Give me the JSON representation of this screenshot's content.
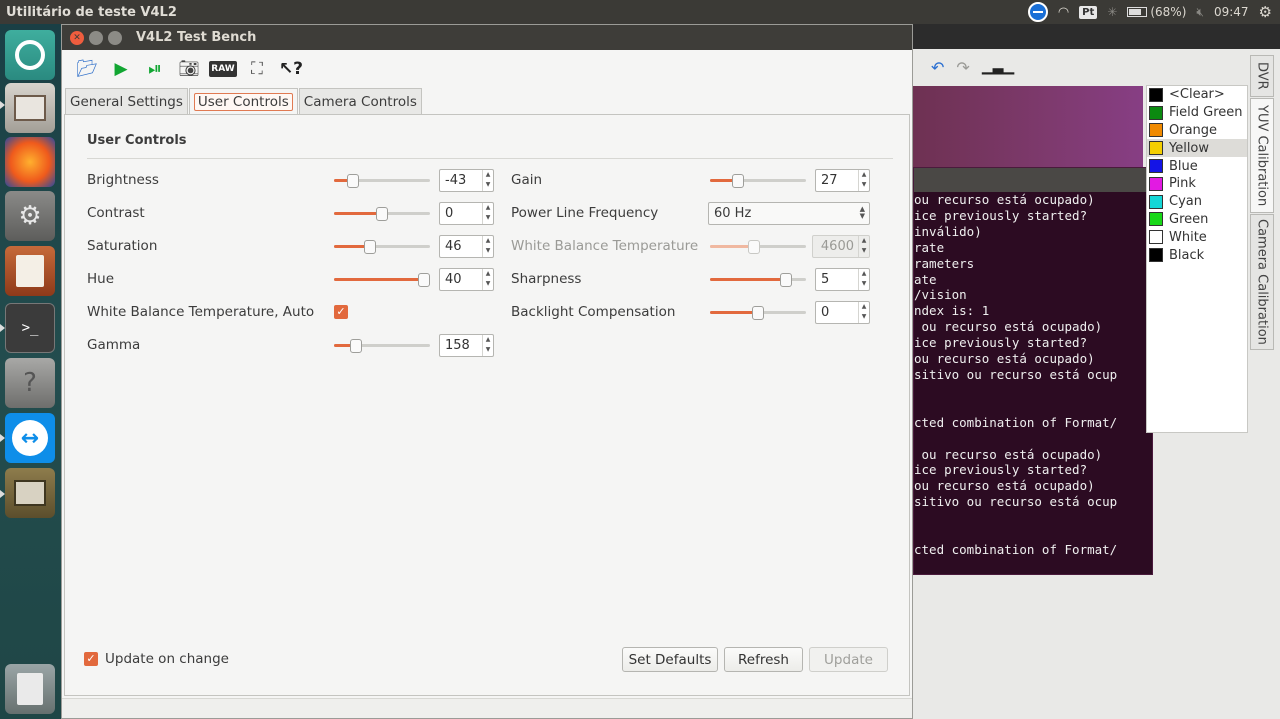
{
  "topbar": {
    "app_title": "Utilitário de teste V4L2",
    "keyboard_layout": "Pt",
    "battery": "(68%)",
    "clock": "09:47"
  },
  "launcher": {
    "items": [
      "ubuntu-dash",
      "files",
      "firefox",
      "system-settings",
      "impress",
      "terminal",
      "help",
      "teamviewer",
      "window"
    ]
  },
  "window": {
    "title": "V4L2 Test Bench",
    "tabs": [
      {
        "label": "General Settings"
      },
      {
        "label": "User Controls"
      },
      {
        "label": "Camera Controls"
      }
    ],
    "group_title": "User Controls",
    "left_controls": [
      {
        "label": "Brightness",
        "value": "-43",
        "fraction": 0.2
      },
      {
        "label": "Contrast",
        "value": "0",
        "fraction": 0.5
      },
      {
        "label": "Saturation",
        "value": "46",
        "fraction": 0.37
      },
      {
        "label": "Hue",
        "value": "40",
        "fraction": 0.94
      },
      {
        "label": "White Balance Temperature, Auto",
        "checked": true
      },
      {
        "label": "Gamma",
        "value": "158",
        "fraction": 0.23
      }
    ],
    "right_controls": [
      {
        "label": "Gain",
        "value": "27",
        "fraction": 0.29
      },
      {
        "label": "Power Line Frequency",
        "select_value": "60 Hz"
      },
      {
        "label": "White Balance Temperature",
        "value": "4600",
        "fraction": 0.46,
        "disabled": true
      },
      {
        "label": "Sharpness",
        "value": "5",
        "fraction": 0.79
      },
      {
        "label": "Backlight Compensation",
        "value": "0",
        "fraction": 0.5
      }
    ],
    "update_on_change": "Update on change",
    "buttons": {
      "set_defaults": "Set Defaults",
      "refresh": "Refresh",
      "update": "Update"
    }
  },
  "background": {
    "terminal_lines": [
      "ou recurso está ocupado)",
      "ice previously started?",
      "inválido)",
      "rate",
      "rameters",
      "ate",
      "/vision",
      "ndex is: 1",
      " ou recurso está ocupado)",
      "ice previously started?",
      "ou recurso está ocupado)",
      "sitivo ou recurso está ocup",
      "",
      "",
      "cted combination of Format/",
      "",
      " ou recurso está ocupado)",
      "ice previously started?",
      "ou recurso está ocupado)",
      "sitivo ou recurso está ocup",
      "",
      "",
      "cted combination of Format/"
    ],
    "color_list": [
      {
        "name": "<Clear>",
        "color": "#000000"
      },
      {
        "name": "Field Green",
        "color": "#0b8a10"
      },
      {
        "name": "Orange",
        "color": "#f08a00"
      },
      {
        "name": "Yellow",
        "color": "#f4cf00",
        "selected": true
      },
      {
        "name": "Blue",
        "color": "#1414e6"
      },
      {
        "name": "Pink",
        "color": "#e21ae2"
      },
      {
        "name": "Cyan",
        "color": "#14d6d6"
      },
      {
        "name": "Green",
        "color": "#18d818"
      },
      {
        "name": "White",
        "color": "#ffffff"
      },
      {
        "name": "Black",
        "color": "#000000"
      }
    ],
    "vertical_tabs": [
      "DVR",
      "YUV Calibration",
      "Camera Calibration"
    ]
  }
}
